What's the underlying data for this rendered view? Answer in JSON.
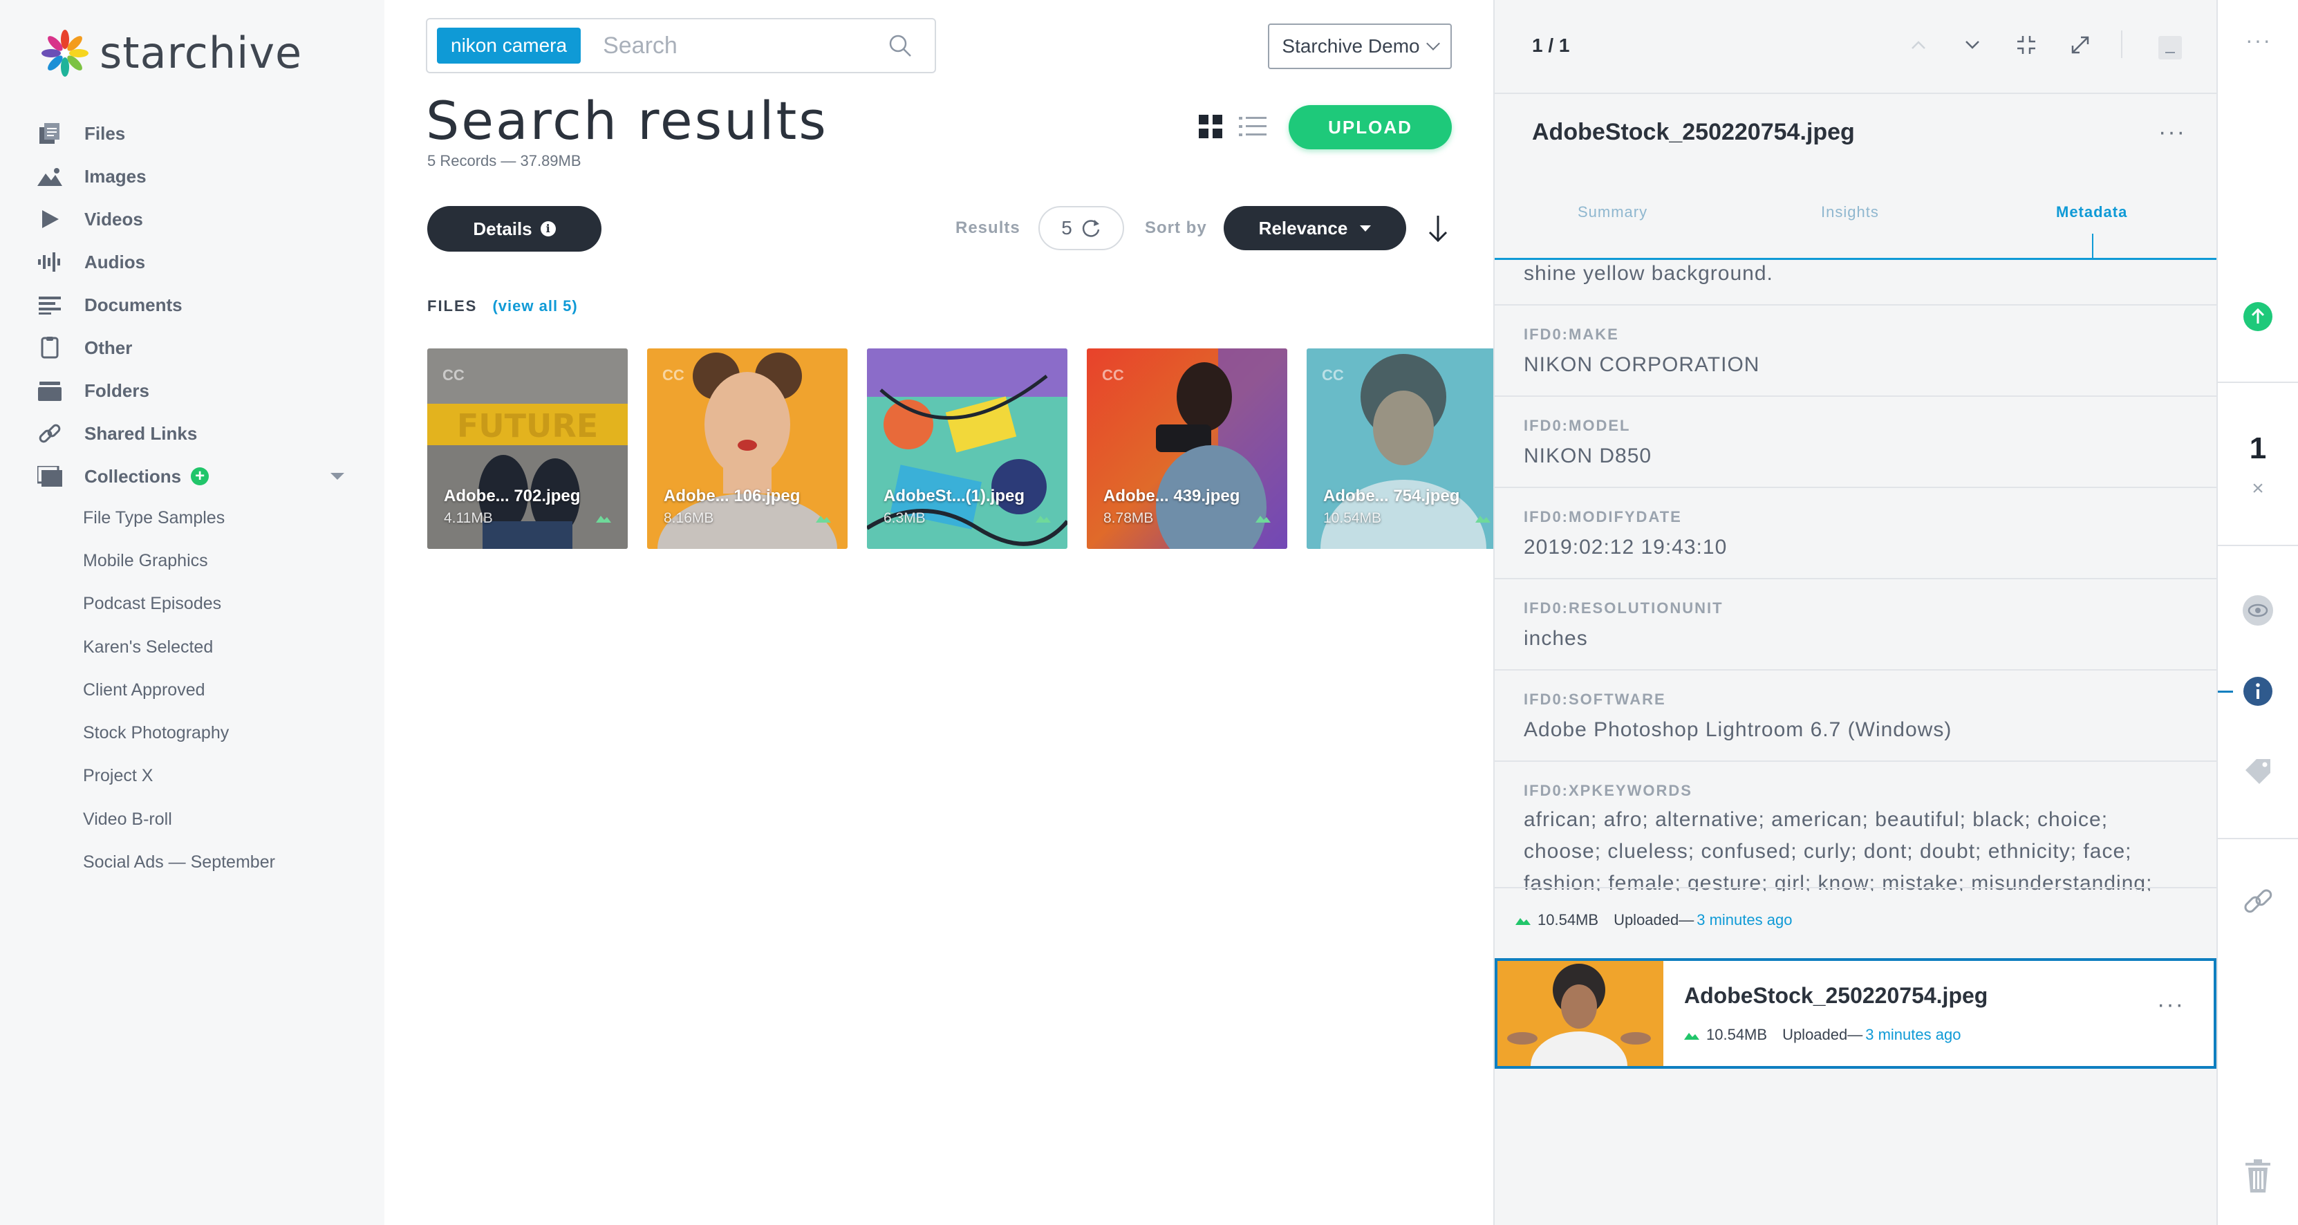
{
  "app": {
    "name": "starchive"
  },
  "sidebar": {
    "nav": [
      {
        "label": "Files",
        "icon": "files-icon"
      },
      {
        "label": "Images",
        "icon": "images-icon"
      },
      {
        "label": "Videos",
        "icon": "videos-icon"
      },
      {
        "label": "Audios",
        "icon": "audios-icon"
      },
      {
        "label": "Documents",
        "icon": "documents-icon"
      },
      {
        "label": "Other",
        "icon": "other-icon"
      },
      {
        "label": "Folders",
        "icon": "folders-icon"
      },
      {
        "label": "Shared Links",
        "icon": "link-icon"
      },
      {
        "label": "Collections",
        "icon": "collections-icon"
      }
    ],
    "collections": [
      "File Type Samples",
      "Mobile Graphics",
      "Podcast Episodes",
      "Karen's Selected",
      "Client Approved",
      "Stock Photography",
      "Project X",
      "Video B-roll",
      "Social Ads — September"
    ]
  },
  "search": {
    "chip": "nikon camera",
    "placeholder": "Search"
  },
  "workspace": "Starchive Demo",
  "main": {
    "title": "Search results",
    "records": "5 Records — 37.89MB",
    "upload_label": "UPLOAD",
    "details_label": "Details",
    "results_label": "Results",
    "results_count": "5",
    "sort_label": "Sort by",
    "sort_value": "Relevance",
    "files_label": "FILES",
    "view_all": "(view all 5)"
  },
  "files": [
    {
      "name": "Adobe... 702.jpeg",
      "size": "4.11MB",
      "badge": "CC"
    },
    {
      "name": "Adobe... 106.jpeg",
      "size": "8.16MB",
      "badge": "CC"
    },
    {
      "name": "AdobeSt...(1).jpeg",
      "size": "6.3MB",
      "badge": ""
    },
    {
      "name": "Adobe... 439.jpeg",
      "size": "8.78MB",
      "badge": "CC"
    },
    {
      "name": "Adobe... 754.jpeg",
      "size": "10.54MB",
      "badge": "CC"
    }
  ],
  "panel": {
    "pager": "1 / 1",
    "file_title": "AdobeStock_250220754.jpeg",
    "tabs": [
      "Summary",
      "Insights",
      "Metadata"
    ],
    "active_tab": "Metadata",
    "meta_partial": "shine yellow background.",
    "metadata": [
      {
        "key": "IFD0:MAKE",
        "value": "NIKON CORPORATION"
      },
      {
        "key": "IFD0:MODEL",
        "value": "NIKON D850"
      },
      {
        "key": "IFD0:MODIFYDATE",
        "value": "2019:02:12 19:43:10"
      },
      {
        "key": "IFD0:RESOLUTIONUNIT",
        "value": "inches"
      },
      {
        "key": "IFD0:SOFTWARE",
        "value": "Adobe Photoshop Lightroom 6.7 (Windows)"
      },
      {
        "key": "IFD0:XPKEYWORDS",
        "value": "african; afro; alternative; american; beautiful; black; choice; choose; clueless; confused; curly; dont; doubt; ethnicity; face; fashion; female; gesture; girl; know; mistake; misunderstanding;"
      }
    ],
    "upload_size": "10.54MB",
    "upload_prefix": "Uploaded—",
    "upload_ago": "3 minutes ago",
    "card": {
      "title": "AdobeStock_250220754.jpeg",
      "size": "10.54MB",
      "prefix": "Uploaded—",
      "ago": "3 minutes ago"
    }
  },
  "rail": {
    "count": "1"
  },
  "colors": {
    "accent": "#0f9ad6",
    "upload": "#1ec97a",
    "dark_button": "#272e38"
  }
}
